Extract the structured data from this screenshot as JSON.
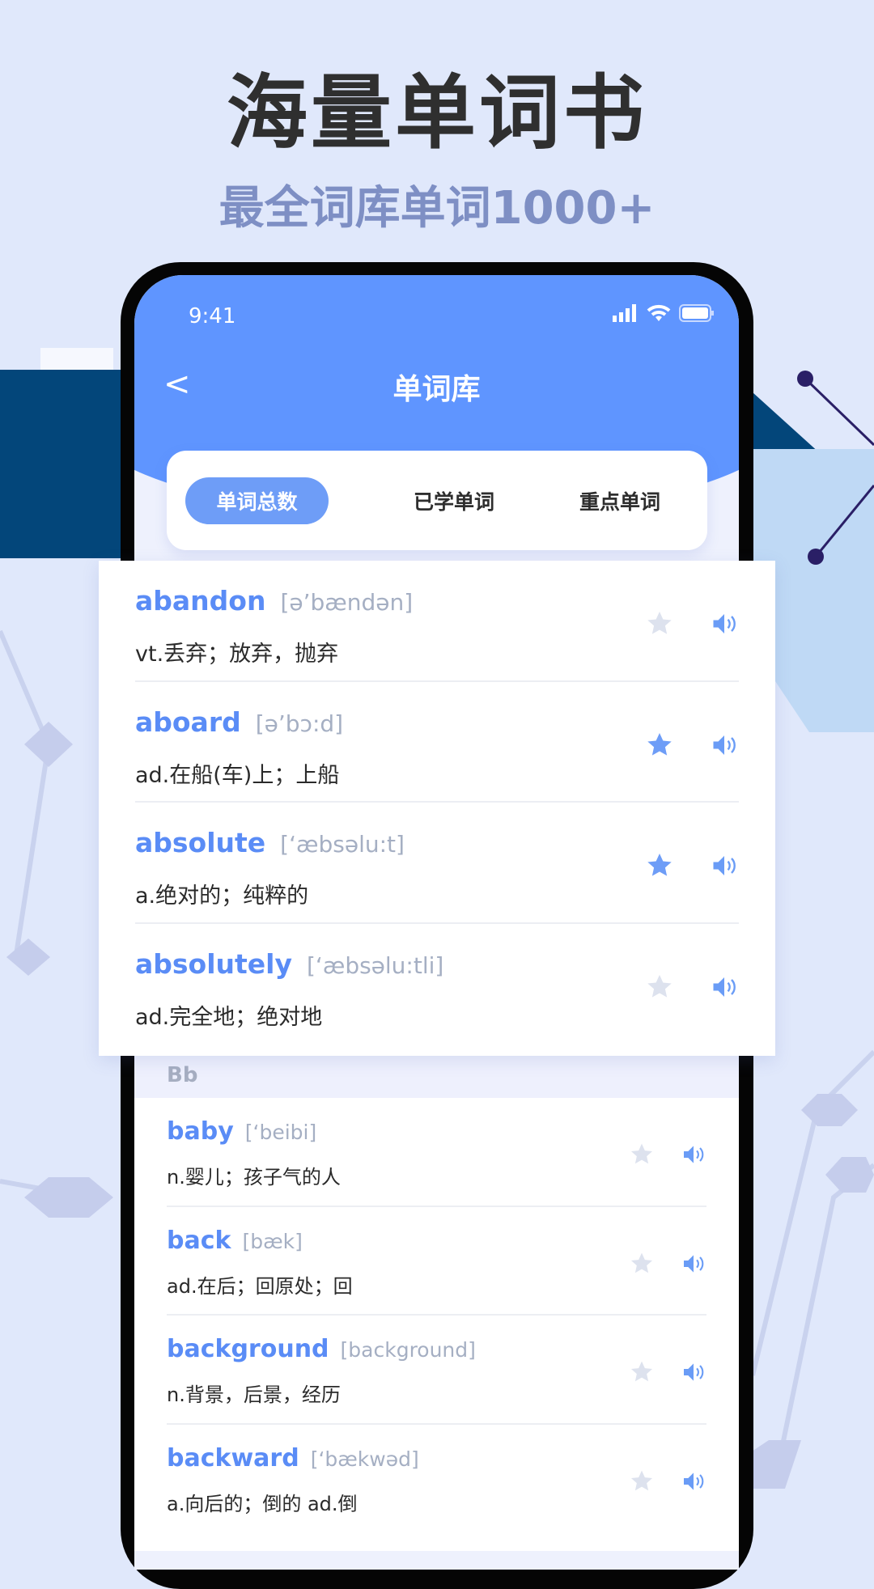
{
  "promo": {
    "headline": "海量单词书",
    "subline": "最全词库单词1000+"
  },
  "status": {
    "time": "9:41"
  },
  "nav": {
    "title": "单词库",
    "back": "<"
  },
  "tabs": [
    {
      "label": "单词总数",
      "active": true
    },
    {
      "label": "已学单词",
      "active": false
    },
    {
      "label": "重点单词",
      "active": false
    }
  ],
  "section_a": [
    {
      "word": "abandon",
      "phonetic": "[ə’bændən]",
      "meaning": "vt.丢弃；放弃，抛弃",
      "starred": false
    },
    {
      "word": "aboard",
      "phonetic": "[ə’bɔ:d]",
      "meaning": "ad.在船(车)上；上船",
      "starred": true
    },
    {
      "word": "absolute",
      "phonetic": "[‘æbsəlu:t]",
      "meaning": "a.绝对的；纯粹的",
      "starred": true
    },
    {
      "word": "absolutely",
      "phonetic": "[‘æbsəlu:tli]",
      "meaning": "ad.完全地；绝对地",
      "starred": false
    }
  ],
  "section_b": {
    "header": "Bb",
    "items": [
      {
        "word": "baby",
        "phonetic": "[‘beibi]",
        "meaning": "n.婴儿；孩子气的人",
        "starred": false
      },
      {
        "word": "back",
        "phonetic": "[bæk]",
        "meaning": "ad.在后；回原处；回",
        "starred": false
      },
      {
        "word": "background",
        "phonetic": "[background]",
        "meaning": "n.背景，后景，经历",
        "starred": false
      },
      {
        "word": "backward",
        "phonetic": "[‘bækwəd]",
        "meaning": "a.向后的；倒的 ad.倒",
        "starred": false
      }
    ]
  },
  "colors": {
    "accent": "#5f95ff",
    "word": "#5a8cf6",
    "star_on": "#6e9df7",
    "star_off": "#dde2ee"
  }
}
